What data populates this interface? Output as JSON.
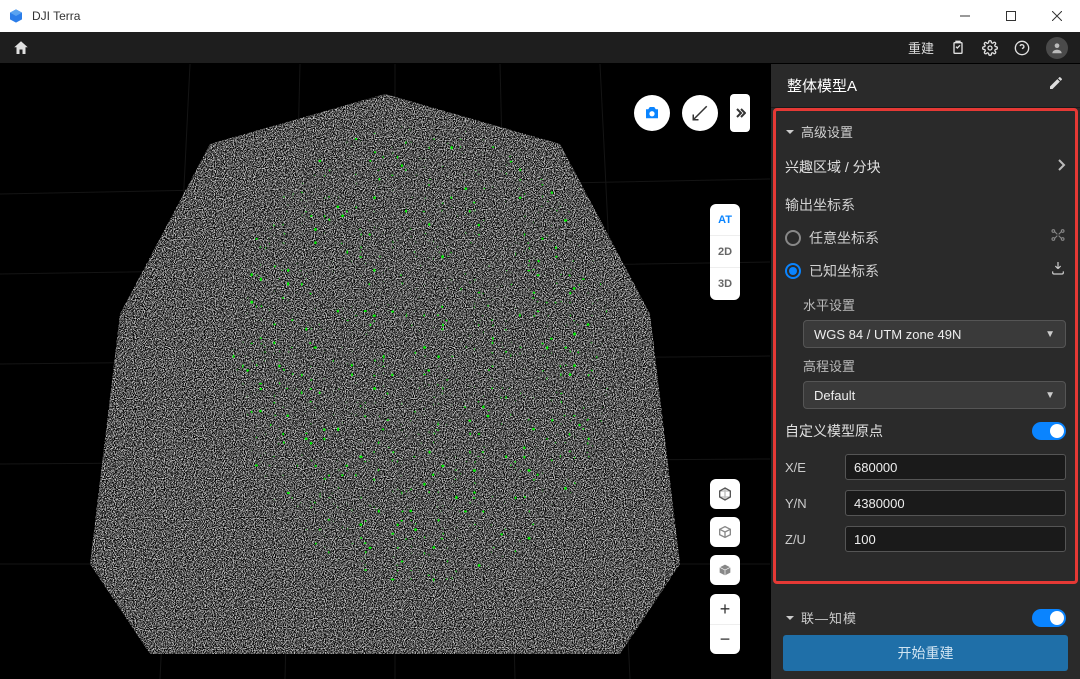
{
  "app": {
    "title": "DJI Terra"
  },
  "toolbar": {
    "rebuild": "重建"
  },
  "viewModes": {
    "at": "AT",
    "d2": "2D",
    "d3": "3D"
  },
  "panel": {
    "title": "整体模型A",
    "advanced": "高级设置",
    "roi": "兴趣区域 / 分块",
    "outputCS": "输出坐标系",
    "arbitraryCS": "任意坐标系",
    "knownCS": "已知坐标系",
    "horizontal": "水平设置",
    "horizontalValue": "WGS 84 / UTM zone 49N",
    "elevation": "高程设置",
    "elevationValue": "Default",
    "customOrigin": "自定义模型原点",
    "xe": {
      "label": "X/E",
      "value": "680000"
    },
    "yn": {
      "label": "Y/N",
      "value": "4380000"
    },
    "zu": {
      "label": "Z/U",
      "value": "100"
    },
    "truncated": "联⁠⁠⁠⁠—⁠知⁠模",
    "button": "开始重建"
  }
}
